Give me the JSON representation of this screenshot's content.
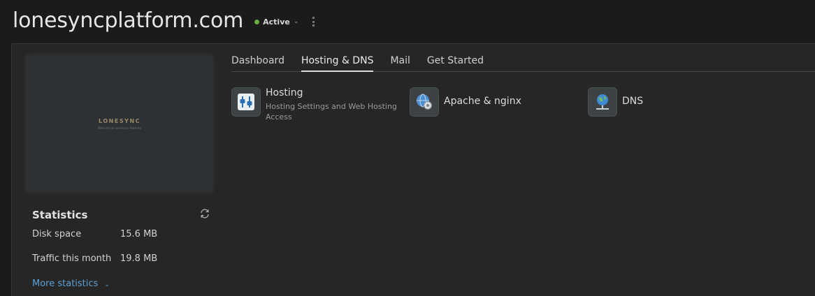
{
  "header": {
    "site_title": "lonesyncplatform.com",
    "status_label": "Active",
    "status_color": "#6aac3c",
    "status_chevron_icon": "chevron-down-icon",
    "menu_icon": "kebab-menu-icon"
  },
  "preview": {
    "logo_text": "LONESYNC",
    "tagline": "Welcome to LoneSync Platform"
  },
  "statistics": {
    "title": "Statistics",
    "refresh_icon": "refresh-icon",
    "rows": [
      {
        "label": "Disk space",
        "value": "15.6 MB"
      },
      {
        "label": "Traffic this month",
        "value": "19.8 MB"
      }
    ],
    "more_label": "More statistics",
    "link_color": "#5da1d6"
  },
  "tabs": [
    {
      "label": "Dashboard",
      "active": false
    },
    {
      "label": "Hosting & DNS",
      "active": true
    },
    {
      "label": "Mail",
      "active": false
    },
    {
      "label": "Get Started",
      "active": false
    }
  ],
  "tiles": [
    {
      "title": "Hosting",
      "description": "Hosting Settings and Web Hosting Access",
      "icon": "hosting-settings-icon"
    },
    {
      "title": "Apache & nginx",
      "description": "",
      "icon": "apache-nginx-gear-icon"
    },
    {
      "title": "DNS",
      "description": "",
      "icon": "dns-globe-icon"
    }
  ]
}
